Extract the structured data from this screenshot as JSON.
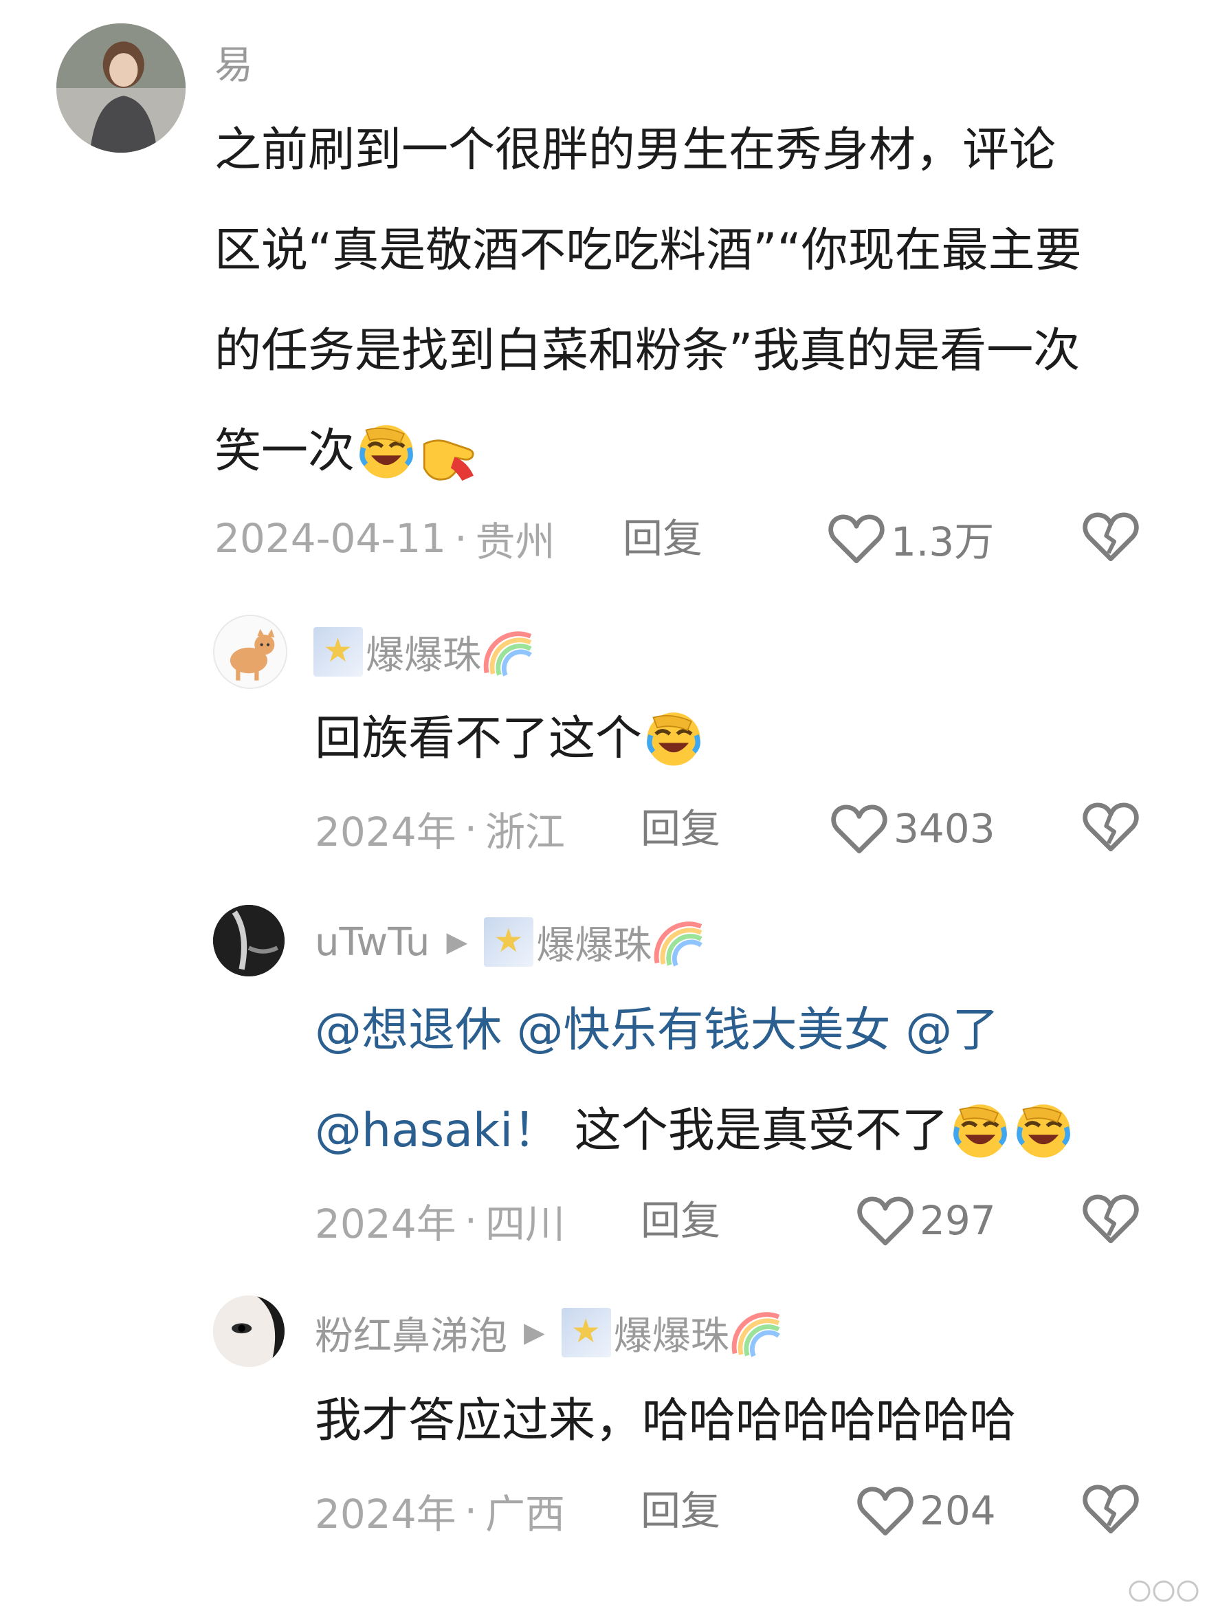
{
  "comments": [
    {
      "username": "易",
      "text_lines": [
        "之前刷到一个很胖的男生在秀身材，评论",
        "区说“真是敬酒不吃吃料酒”“你现在最主要",
        "的任务是找到白菜和粉条”我真的是看一次",
        "笑一次"
      ],
      "date": "2024-04-11",
      "location": "贵州",
      "reply_label": "回复",
      "likes": "1.3万"
    },
    {
      "username": "爆爆珠",
      "text": "回族看不了这个",
      "date": "2024年",
      "location": "浙江",
      "reply_label": "回复",
      "likes": "3403"
    },
    {
      "username": "uTwTu",
      "reply_to": "爆爆珠",
      "mentions_line1": [
        "@想退休",
        "@快乐有钱大美女",
        "@了"
      ],
      "mention_line2": "@hasaki！",
      "text": "这个我是真受不了",
      "date": "2024年",
      "location": "四川",
      "reply_label": "回复",
      "likes": "297"
    },
    {
      "username": "粉红鼻涕泡",
      "reply_to": "爆爆珠",
      "text": "我才答应过来，哈哈哈哈哈哈哈哈",
      "date": "2024年",
      "location": "广西",
      "reply_label": "回复",
      "likes": "204"
    }
  ],
  "separator_dot": "·",
  "icons": {
    "like": "heart-outline-icon",
    "dislike": "broken-heart-icon",
    "emoji": "rolling-laughing-emoji",
    "point": "pointing-hand-emoji",
    "arrow": "reply-arrow-icon",
    "badge": "star-badge-icon",
    "rainbow": "rainbow-emoji"
  },
  "colors": {
    "mention": "#2b5f8f",
    "meta": "#a8a8a8",
    "text": "#1c1c1c"
  }
}
